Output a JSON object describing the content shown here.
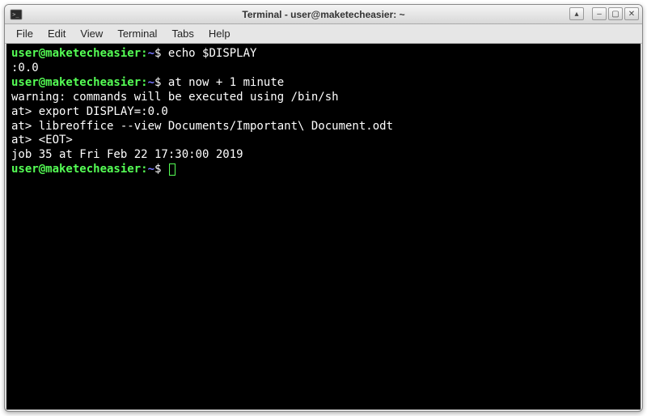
{
  "window": {
    "title": "Terminal - user@maketecheasier: ~"
  },
  "titlebar_buttons": {
    "up": "▴",
    "min": "–",
    "max": "▢",
    "close": "✕"
  },
  "menubar": {
    "items": [
      {
        "label": "File"
      },
      {
        "label": "Edit"
      },
      {
        "label": "View"
      },
      {
        "label": "Terminal"
      },
      {
        "label": "Tabs"
      },
      {
        "label": "Help"
      }
    ]
  },
  "prompt": {
    "user_host": "user@maketecheasier",
    "sep": ":",
    "cwd": "~",
    "symbol": "$"
  },
  "session": {
    "lines": [
      {
        "type": "prompt",
        "cmd": "echo $DISPLAY"
      },
      {
        "type": "output",
        "text": ":0.0"
      },
      {
        "type": "prompt",
        "cmd": "at now + 1 minute"
      },
      {
        "type": "output",
        "text": "warning: commands will be executed using /bin/sh"
      },
      {
        "type": "output",
        "text": "at> export DISPLAY=:0.0"
      },
      {
        "type": "output",
        "text": "at> libreoffice --view Documents/Important\\ Document.odt"
      },
      {
        "type": "output",
        "text": "at> <EOT>"
      },
      {
        "type": "output",
        "text": "job 35 at Fri Feb 22 17:30:00 2019"
      },
      {
        "type": "prompt",
        "cmd": "",
        "cursor": true
      }
    ]
  }
}
